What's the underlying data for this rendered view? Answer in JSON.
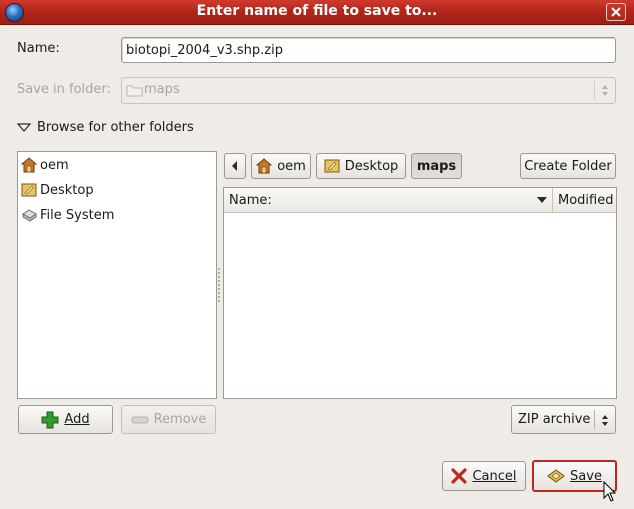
{
  "window": {
    "title": "Enter name of file to save to..."
  },
  "name_field": {
    "label": "Name:",
    "value": "biotopi_2004_v3.shp.zip"
  },
  "save_in": {
    "label": "Save in folder:",
    "value": "maps"
  },
  "browse_toggle": {
    "label": "Browse for other folders"
  },
  "places": [
    {
      "label": "oem",
      "icon": "home-folder-icon"
    },
    {
      "label": "Desktop",
      "icon": "desktop-icon"
    },
    {
      "label": "File System",
      "icon": "harddisk-icon"
    }
  ],
  "path_bar": {
    "segments": [
      "oem",
      "Desktop",
      "maps"
    ],
    "active": "maps"
  },
  "create_folder": {
    "label": "Create Folder"
  },
  "file_list": {
    "columns": {
      "name": "Name:",
      "modified": "Modified"
    },
    "rows": []
  },
  "add_button": {
    "label": "Add"
  },
  "remove_button": {
    "label": "Remove"
  },
  "filter": {
    "value": "ZIP archive"
  },
  "cancel_button": {
    "label": "Cancel"
  },
  "save_button": {
    "label": "Save"
  },
  "colors": {
    "title_bar": "#b3261a",
    "dialog_bg": "#efebe7",
    "save_focus": "#c1271b",
    "add_plus": "#2e9b2a"
  }
}
